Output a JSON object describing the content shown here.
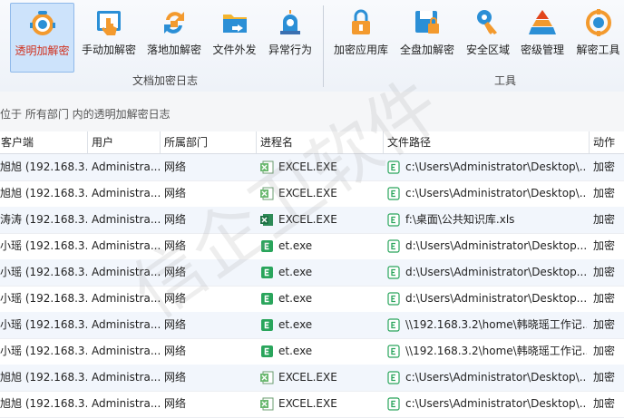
{
  "ribbon": {
    "group1": {
      "label": "文档加密日志",
      "buttons": [
        {
          "label": "透明加解密",
          "icon": "robot-eye-icon",
          "active": true
        },
        {
          "label": "手动加解密",
          "icon": "hand-pointer-icon"
        },
        {
          "label": "落地加解密",
          "icon": "sync-lock-icon"
        },
        {
          "label": "文件外发",
          "icon": "folder-send-icon"
        },
        {
          "label": "异常行为",
          "icon": "alarm-siren-icon"
        }
      ]
    },
    "group2": {
      "label": "工具",
      "buttons": [
        {
          "label": "加密应用库",
          "icon": "lock-icon"
        },
        {
          "label": "全盘加解密",
          "icon": "disk-lock-icon"
        },
        {
          "label": "安全区域",
          "icon": "key-icon"
        },
        {
          "label": "密级管理",
          "icon": "pyramid-icon"
        },
        {
          "label": "解密工具",
          "icon": "decrypt-tool-icon"
        }
      ]
    }
  },
  "breadcrumb": "位于 所有部门 内的透明加解密日志",
  "columns": [
    "客户端",
    "用户",
    "所属部门",
    "进程名",
    "文件路径",
    "动作"
  ],
  "rows": [
    {
      "client": "旭旭 (192.168.3...",
      "user": "Administra...",
      "dept": "网络",
      "process": "EXCEL.EXE",
      "path": "c:\\Users\\Administrator\\Desktop\\...",
      "action": "加密",
      "ptype": "excel-light"
    },
    {
      "client": "旭旭 (192.168.3...",
      "user": "Administra...",
      "dept": "网络",
      "process": "EXCEL.EXE",
      "path": "c:\\Users\\Administrator\\Desktop\\...",
      "action": "加密",
      "ptype": "excel-light"
    },
    {
      "client": "涛涛 (192.168.3...",
      "user": "Administra...",
      "dept": "网络",
      "process": "EXCEL.EXE",
      "path": "f:\\桌面\\公共知识库.xls",
      "action": "加密",
      "ptype": "excel-dark"
    },
    {
      "client": "小瑶 (192.168.3...",
      "user": "Administra...",
      "dept": "网络",
      "process": "et.exe",
      "path": "d:\\Users\\Administrator\\Desktop...",
      "action": "加密",
      "ptype": "et"
    },
    {
      "client": "小瑶 (192.168.3...",
      "user": "Administra...",
      "dept": "网络",
      "process": "et.exe",
      "path": "d:\\Users\\Administrator\\Desktop...",
      "action": "加密",
      "ptype": "et"
    },
    {
      "client": "小瑶 (192.168.3...",
      "user": "Administra...",
      "dept": "网络",
      "process": "et.exe",
      "path": "d:\\Users\\Administrator\\Desktop...",
      "action": "加密",
      "ptype": "et"
    },
    {
      "client": "小瑶 (192.168.3...",
      "user": "Administra...",
      "dept": "网络",
      "process": "et.exe",
      "path": "\\\\192.168.3.2\\home\\韩晓瑶工作记...",
      "action": "加密",
      "ptype": "et"
    },
    {
      "client": "小瑶 (192.168.3...",
      "user": "Administra...",
      "dept": "网络",
      "process": "et.exe",
      "path": "\\\\192.168.3.2\\home\\韩晓瑶工作记...",
      "action": "加密",
      "ptype": "et"
    },
    {
      "client": "旭旭 (192.168.3...",
      "user": "Administra...",
      "dept": "网络",
      "process": "EXCEL.EXE",
      "path": "c:\\Users\\Administrator\\Desktop\\...",
      "action": "加密",
      "ptype": "excel-light"
    },
    {
      "client": "旭旭 (192.168.3...",
      "user": "Administra...",
      "dept": "网络",
      "process": "EXCEL.EXE",
      "path": "c:\\Users\\Administrator\\Desktop\\...",
      "action": "加密",
      "ptype": "excel-light"
    }
  ],
  "watermark": "信企卫软件",
  "colors": {
    "active_text": "#d0301d",
    "active_bg": "#cde3fb",
    "excel_green": "#1e7145",
    "et_green": "#2aa55c",
    "row_alt": "#f2f6fc"
  }
}
